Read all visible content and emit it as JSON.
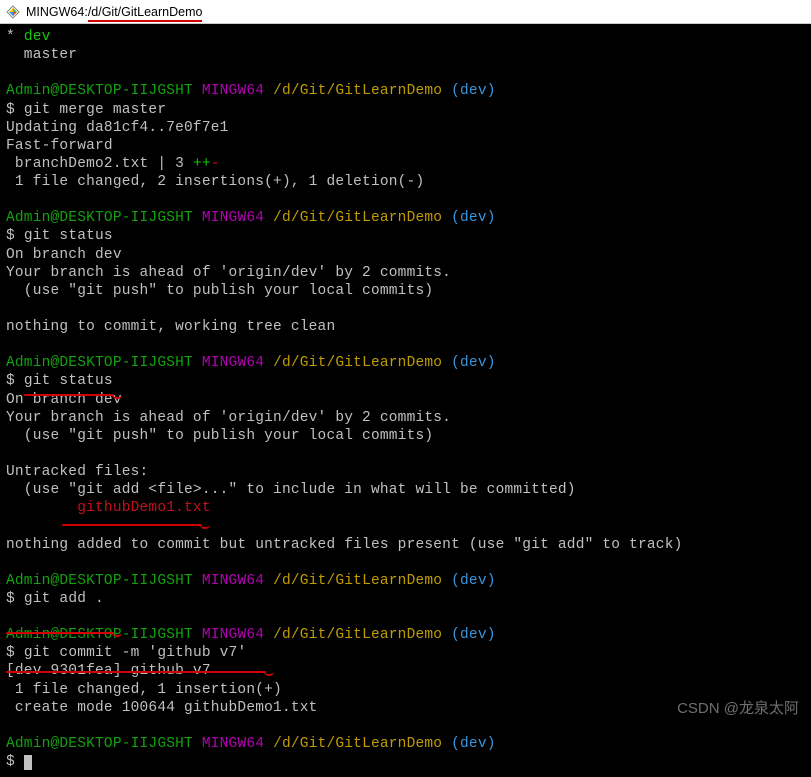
{
  "window": {
    "title_prefix": "MINGW64:",
    "title_path": "/d/Git/GitLearnDemo"
  },
  "branches": {
    "star": "*",
    "dev": "dev",
    "master": "  master"
  },
  "prompt": {
    "user": "Admin@DESKTOP-IIJGSHT",
    "host": "MINGW64",
    "path": "/d/Git/GitLearnDemo",
    "branch_open": "(",
    "branch": "dev",
    "branch_close": ")",
    "dollar": "$ "
  },
  "cmd": {
    "merge": "git merge master",
    "status1": "git status",
    "status2": "git status",
    "add": "git add .",
    "commit": "git commit -m 'github v7'"
  },
  "merge_out": {
    "l1": "Updating da81cf4..7e0f7e1",
    "l2": "Fast-forward",
    "l3a": " branchDemo2.txt | 3 ",
    "l3b": "++",
    "l3c": "-",
    "l4": " 1 file changed, 2 insertions(+), 1 deletion(-)"
  },
  "status1_out": {
    "l1": "On branch dev",
    "l2": "Your branch is ahead of 'origin/dev' by 2 commits.",
    "l3": "  (use \"git push\" to publish your local commits)",
    "l4": "nothing to commit, working tree clean"
  },
  "status2_out": {
    "l1": "On branch dev",
    "l2": "Your branch is ahead of 'origin/dev' by 2 commits.",
    "l3": "  (use \"git push\" to publish your local commits)",
    "l4": "Untracked files:",
    "l5": "  (use \"git add <file>...\" to include in what will be committed)",
    "l6": "        githubDemo1.txt",
    "l7": "nothing added to commit but untracked files present (use \"git add\" to track)"
  },
  "commit_out": {
    "l1": "[dev 9301fea] github v7",
    "l2": " 1 file changed, 1 insertion(+)",
    "l3": " create mode 100644 githubDemo1.txt"
  },
  "watermark": "CSDN @龙泉太阿"
}
